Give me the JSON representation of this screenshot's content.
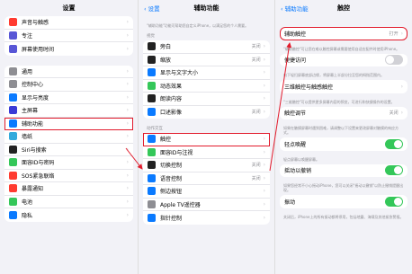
{
  "panel1": {
    "title": "设置",
    "group1": [
      {
        "label": "声音与触感",
        "icon": "sound-icon",
        "color": "#ff3b30"
      },
      {
        "label": "专注",
        "icon": "moon-icon",
        "color": "#5856d6"
      },
      {
        "label": "屏幕使用时间",
        "icon": "hourglass-icon",
        "color": "#5856d6"
      }
    ],
    "group2": [
      {
        "label": "通用",
        "icon": "gear-icon",
        "color": "#8e8e93"
      },
      {
        "label": "控制中心",
        "icon": "switches-icon",
        "color": "#8e8e93"
      },
      {
        "label": "显示与亮度",
        "icon": "brightness-icon",
        "color": "#0a7aff"
      },
      {
        "label": "主屏幕",
        "icon": "grid-icon",
        "color": "#3a3ad6"
      },
      {
        "label": "辅助功能",
        "icon": "accessibility-icon",
        "color": "#0a7aff"
      },
      {
        "label": "墙纸",
        "icon": "flower-icon",
        "color": "#34aadc"
      },
      {
        "label": "Siri与搜索",
        "icon": "siri-icon",
        "color": "#222222"
      },
      {
        "label": "面容ID与密码",
        "icon": "faceid-icon",
        "color": "#34c759"
      },
      {
        "label": "SOS紧急联络",
        "icon": "sos-icon",
        "color": "#ff3b30"
      },
      {
        "label": "暴露通知",
        "icon": "virus-icon",
        "color": "#ff3b30"
      },
      {
        "label": "电池",
        "icon": "battery-icon",
        "color": "#34c759"
      },
      {
        "label": "隐私",
        "icon": "hand-icon",
        "color": "#0a7aff"
      }
    ]
  },
  "panel2": {
    "back": "设置",
    "title": "辅助功能",
    "intro": "\"辅助功能\"功能可帮助您自定义iPhone，以满足您的个人需要。",
    "vision_header": "视觉",
    "vision": [
      {
        "label": "旁白",
        "value": "关闭",
        "icon": "voiceover-icon",
        "color": "#222222"
      },
      {
        "label": "缩放",
        "value": "关闭",
        "icon": "zoom-icon",
        "color": "#222222"
      },
      {
        "label": "显示与文字大小",
        "value": "",
        "icon": "textsize-icon",
        "color": "#0a7aff"
      },
      {
        "label": "动态效果",
        "value": "",
        "icon": "motion-icon",
        "color": "#34c759"
      },
      {
        "label": "朗读内容",
        "value": "",
        "icon": "speech-icon",
        "color": "#222222"
      },
      {
        "label": "口述影像",
        "value": "关闭",
        "icon": "audiodesc-icon",
        "color": "#0a7aff"
      }
    ],
    "interaction_header": "动作交互",
    "interaction": [
      {
        "label": "触控",
        "value": "",
        "icon": "touch-icon",
        "color": "#0a7aff"
      },
      {
        "label": "面容ID与注视",
        "value": "",
        "icon": "faceid-icon",
        "color": "#34c759"
      },
      {
        "label": "切换控制",
        "value": "关闭",
        "icon": "switch-control-icon",
        "color": "#222222"
      },
      {
        "label": "语音控制",
        "value": "关闭",
        "icon": "voice-control-icon",
        "color": "#0a7aff"
      },
      {
        "label": "侧边按钮",
        "value": "",
        "icon": "side-button-icon",
        "color": "#0a7aff"
      },
      {
        "label": "Apple TV遥控器",
        "value": "",
        "icon": "remote-icon",
        "color": "#8e8e93"
      },
      {
        "label": "指针控制",
        "value": "",
        "icon": "pointer-icon",
        "color": "#0a7aff"
      }
    ]
  },
  "panel3": {
    "back": "辅助功能",
    "title": "触控",
    "assistive_label": "辅助触控",
    "assistive_value": "打开",
    "assistive_note": "\"辅助触控\"可让您在难以触控屏幕或需要使用自适应配件时使用iPhone。",
    "reach_label": "便捷访问",
    "reach_note": "向下轻扫屏幕底部边缘，将屏幕上半部分拉至您的拇指范围内。",
    "haptic_label": "三维触控与触感触控",
    "haptic_value": "",
    "haptic_note": "\"三维触控\"可以提供更多屏幕内容的预览，可进行和快捷操作的设置。",
    "accom_label": "触控调节",
    "accom_value": "关闭",
    "accom_note": "如果在触摸屏幕时遇到困难，请调整以下设置来更改屏幕对触摸的响应方式。",
    "tapwake_label": "轻点唤醒",
    "tapwake_note": "轻点屏幕以唤醒屏幕。",
    "shake_label": "摇动以撤销",
    "shake_note": "如果您经常不小心摇动iPhone，您可以关闭\"摇动以撤销\"以防止撤销提醒出现。",
    "vibration_label": "振动",
    "vibration_note": "关闭后，iPhone上的所有振动都将停用，包括地震、海啸及其他紧急警报。",
    "on_color": "#34c759",
    "highlight_color": "#e21b2c"
  }
}
